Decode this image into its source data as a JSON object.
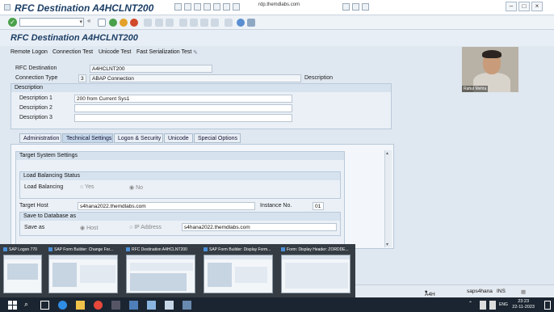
{
  "window": {
    "title": "RFC Destination A4HCLNT200",
    "rdp_host": "rdp.themdlabs.com"
  },
  "toolbar": {
    "command_field": ""
  },
  "page": {
    "title": "RFC Destination A4HCLNT200"
  },
  "app_toolbar": {
    "buttons": [
      "Remote Logon",
      "Connection Test",
      "Unicode Test",
      "Fast Serialization Test"
    ]
  },
  "form": {
    "rfc_destination_label": "RFC Destination",
    "rfc_destination_value": "A4HCLNT200",
    "connection_type_label": "Connection Type",
    "connection_type_code": "3",
    "connection_type_value": "ABAP Connection",
    "description_suffix": "Description",
    "description_section": "Description",
    "description1_label": "Description 1",
    "description1_value": "200 from Current Sys1",
    "description2_label": "Description 2",
    "description2_value": "",
    "description3_label": "Description 3",
    "description3_value": ""
  },
  "tabs": [
    "Administration",
    "Technical Settings",
    "Logon & Security",
    "Unicode",
    "Special Options"
  ],
  "technical": {
    "target_system_settings": "Target System Settings",
    "load_balancing_status": "Load Balancing Status",
    "load_balancing_label": "Load Balancing",
    "yes": "Yes",
    "no": "No",
    "target_host_label": "Target Host",
    "target_host_value": "s4hana2022.themdlabs.com",
    "instance_label": "Instance No.",
    "instance_value": "01",
    "save_db_as": "Save to Database as",
    "save_as_label": "Save as",
    "host": "Host",
    "ip_address": "IP Address",
    "save_as_value": "s4hana2022.themdlabs.com"
  },
  "video": {
    "name": "Rahul Mehta"
  },
  "thumbnails": [
    "SAP Logon 770",
    "SAP Form Builder: Change For...",
    "RFC Destination A4HCLNT200",
    "SAP Form Builder: Display Form...",
    "Form: Display Header: ZORDDE..."
  ],
  "status": {
    "system": "A4H (2) 100",
    "server": "saps4hana",
    "mode": "INS"
  },
  "taskbar": {
    "lang": "ENG",
    "time": "23:23",
    "date": "22-11-2023"
  },
  "colors": {
    "sap_title": "#1c3f66",
    "taskbar": "#1b2531",
    "active_tab": "#c6d8ea"
  }
}
